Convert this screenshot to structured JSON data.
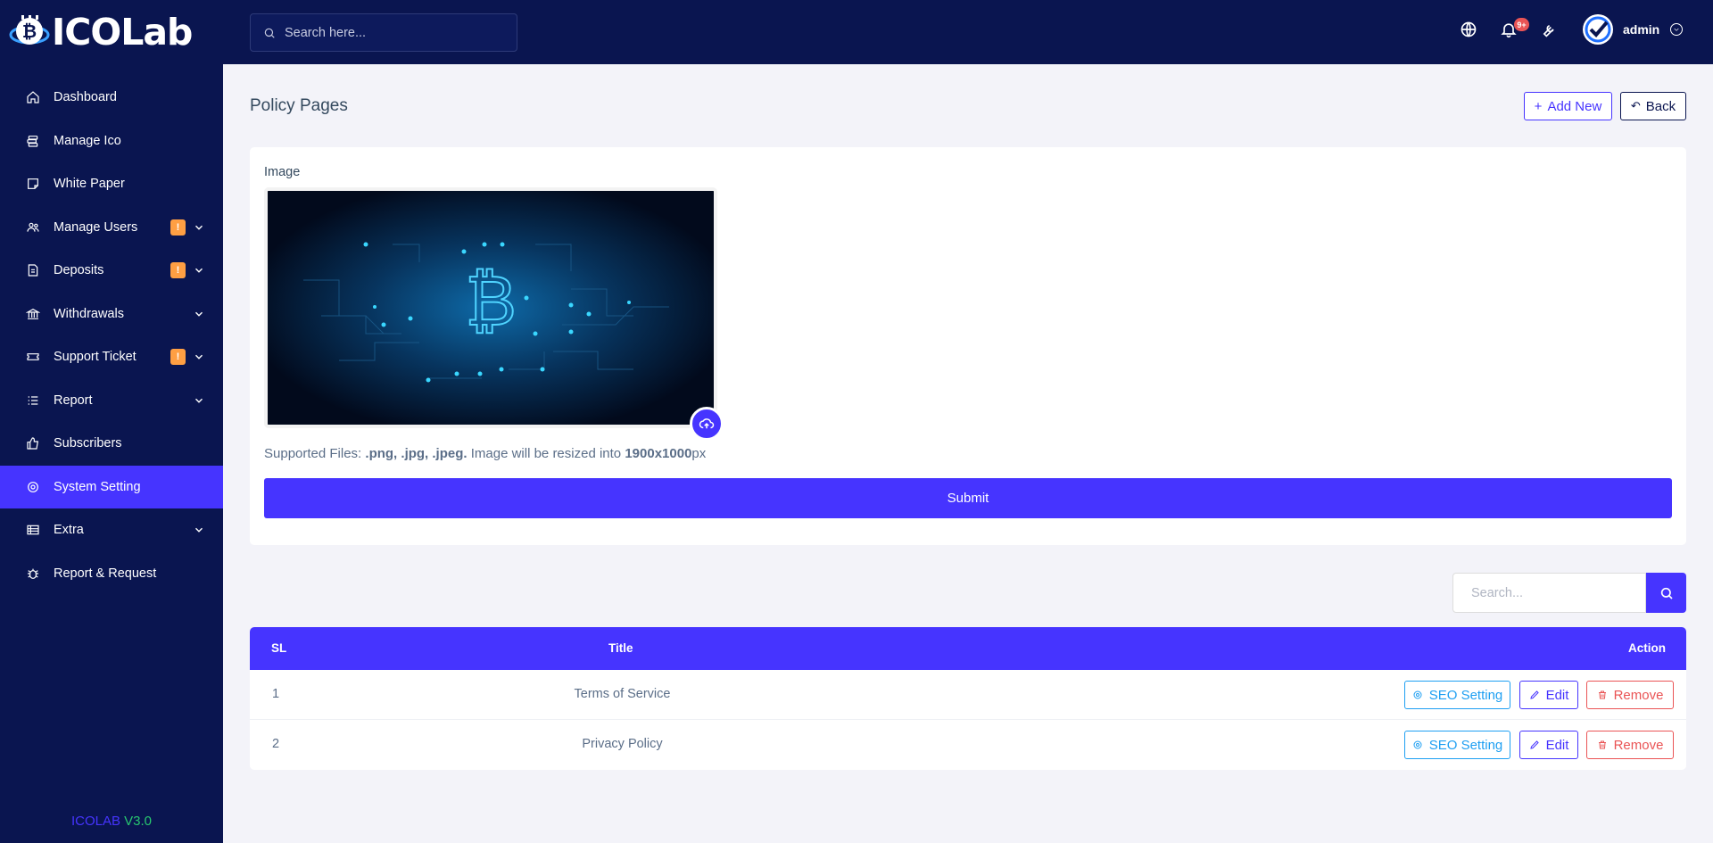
{
  "brand": {
    "logo_ico": "ICO",
    "logo_lab": "Lab"
  },
  "sidebar": {
    "items": [
      {
        "label": "Dashboard"
      },
      {
        "label": "Manage Ico"
      },
      {
        "label": "White Paper"
      },
      {
        "label": "Manage Users",
        "badge": "!"
      },
      {
        "label": "Deposits",
        "badge": "!"
      },
      {
        "label": "Withdrawals"
      },
      {
        "label": "Support Ticket",
        "badge": "!"
      },
      {
        "label": "Report"
      },
      {
        "label": "Subscribers"
      },
      {
        "label": "System Setting"
      },
      {
        "label": "Extra"
      },
      {
        "label": "Report & Request"
      }
    ],
    "version_name": "ICOLAB",
    "version_number": "V3.0"
  },
  "topbar": {
    "search_placeholder": "Search here...",
    "notification_count": "9+",
    "user_name": "admin"
  },
  "page": {
    "title": "Policy Pages",
    "add_new_label": "Add New",
    "back_label": "Back"
  },
  "form": {
    "image_label": "Image",
    "supported_prefix": "Supported Files:",
    "supported_types": ".png, .jpg, .jpeg.",
    "resize_text": "Image will be resized into",
    "resize_size": "1900x1000",
    "resize_unit": "px",
    "submit_label": "Submit"
  },
  "table_search": {
    "placeholder": "Search..."
  },
  "table": {
    "headers": {
      "sl": "SL",
      "title": "Title",
      "action": "Action"
    },
    "rows": [
      {
        "sl": "1",
        "title": "Terms of Service"
      },
      {
        "sl": "2",
        "title": "Privacy Policy"
      }
    ],
    "actions": {
      "seo": "SEO Setting",
      "edit": "Edit",
      "remove": "Remove"
    }
  },
  "colors": {
    "primary": "#4634ff",
    "sidebar": "#0a1550",
    "warning": "#ff9f43",
    "info": "#1e9ff2",
    "danger": "#ea5455"
  }
}
